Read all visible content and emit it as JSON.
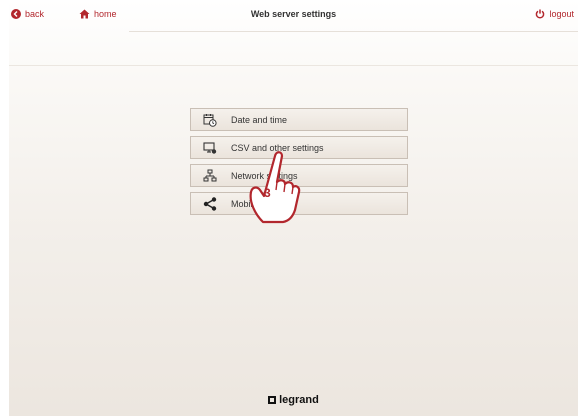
{
  "header": {
    "title": "Web server settings",
    "back_label": "back",
    "home_label": "home",
    "logout_label": "logout"
  },
  "menu": {
    "items": [
      {
        "label": "Date and time",
        "icon": "calendar-clock-icon"
      },
      {
        "label": "CSV and other settings",
        "icon": "monitor-settings-icon"
      },
      {
        "label": "Network settings",
        "icon": "network-icon"
      },
      {
        "label": "Mobile settings",
        "icon": "share-icon"
      }
    ]
  },
  "annotation": {
    "step_number": "3"
  },
  "footer": {
    "brand": "legrand"
  },
  "colors": {
    "accent": "#b2272d",
    "text": "#333333"
  }
}
